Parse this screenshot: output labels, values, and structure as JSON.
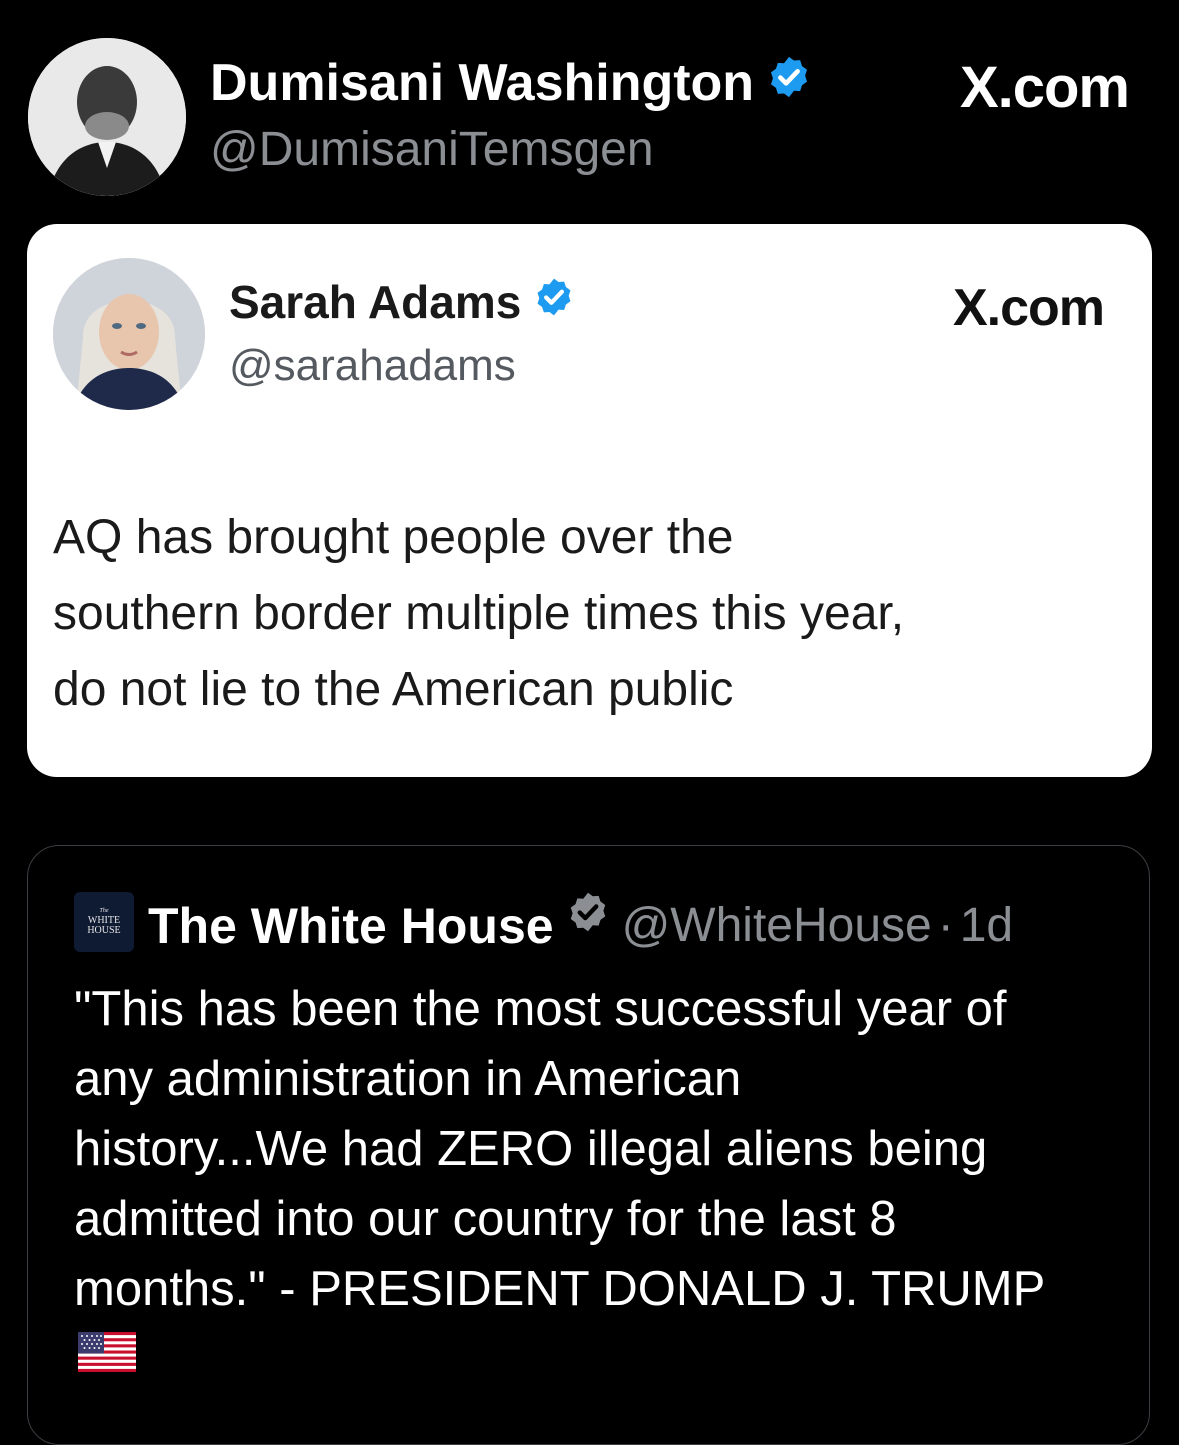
{
  "retweeter": {
    "name": "Dumisani Washington",
    "handle": "@DumisaniTemsgen",
    "site": "X.com"
  },
  "embedded_post": {
    "name": "Sarah Adams",
    "handle": "@sarahadams",
    "site": "X.com",
    "lines": [
      "AQ has brought people over the",
      "southern border multiple times this year,",
      "do not lie to the American public"
    ]
  },
  "quoted_post": {
    "logo_lines": [
      "The",
      "WHITE",
      "HOUSE"
    ],
    "name": "The White House",
    "handle": "@WhiteHouse",
    "separator": "·",
    "time": "1d",
    "lines": [
      "\"This has been the most successful year of",
      "any administration in American",
      "history...We had ZERO illegal aliens being",
      "admitted into our country for the last 8",
      "months.\" - PRESIDENT DONALD J. TRUMP"
    ],
    "emoji": "flag-us-icon"
  },
  "colors": {
    "background": "#000000",
    "verified_blue": "#1d9bf0",
    "verified_gray": "#8b8f94",
    "muted_text": "#8b8f94"
  }
}
